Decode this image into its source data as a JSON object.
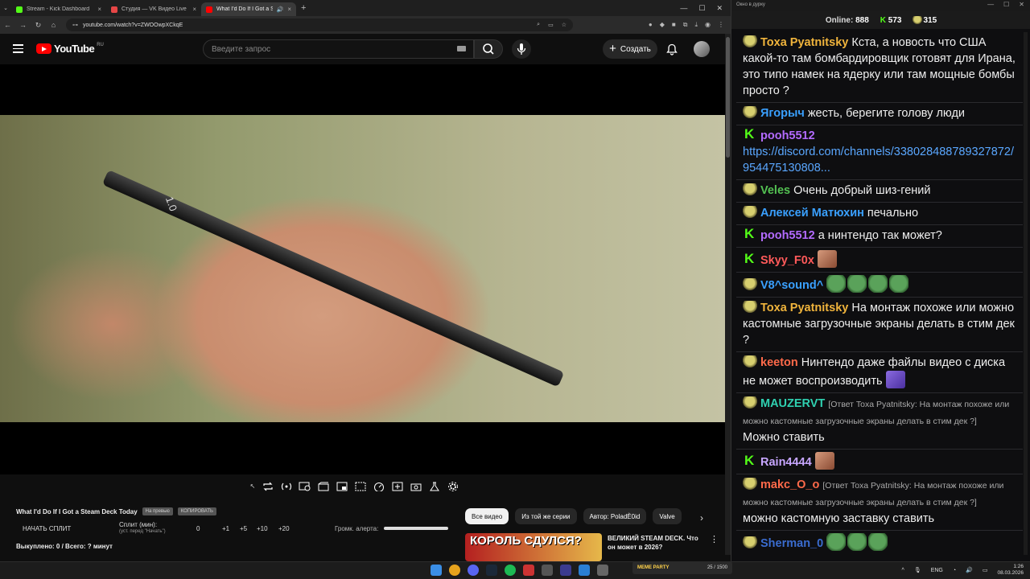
{
  "browser": {
    "tabs": [
      {
        "label": "Stream - Kick Dashboard",
        "color": "#53fc18"
      },
      {
        "label": "Студия — VK Видео Live",
        "color": "#e64646"
      },
      {
        "label": "What I'd Do If I Got a Steam",
        "color": "#ff0000"
      }
    ],
    "url": "youtube.com/watch?v=ZWOOwpXCkqE"
  },
  "youtube": {
    "logo": "YouTube",
    "region": "RU",
    "search_placeholder": "Введите запрос",
    "create_label": "Создать"
  },
  "video": {
    "pen_label": "1.0",
    "title": "What I'd Do If I Got a Steam Deck Today",
    "pill1": "На превью",
    "pill2": "КОПИРОВАТЬ",
    "start_split": "НАЧАТЬ СПЛИТ",
    "split_label": "Сплит (мин):",
    "split_sub": "(уст. перед \"Начать\")",
    "split_values": [
      "0",
      "+1",
      "+5",
      "+10",
      "+20"
    ],
    "alert_volume_label": "Громк. алерта:",
    "bought": "Выкуплено: 0 / Всего: ? минут"
  },
  "recommendations": {
    "chips": [
      "Все видео",
      "Из той же серии",
      "Автор: PoladЀ0id",
      "Valve"
    ],
    "first_title": "ВЕЛИКИЙ STEAM DECK. Что он может в 2026?",
    "thumb_text": "КОРОЛЬ СДУЛСЯ?"
  },
  "chat": {
    "window_title": "Окно в дурку",
    "online_label": "Online:",
    "online": "888",
    "kick_count": "573",
    "yt_count": "315",
    "messages": [
      {
        "badge": "yt",
        "nick": "Toxa Pyatnitsky",
        "color": "#f0b43c",
        "text": "Кста, а новость что США какой-то там бомбардировщик готовят для Ирана, это типо намек на ядерку или там мощные бомбы просто ?"
      },
      {
        "badge": "yt",
        "nick": "Ягорыч",
        "color": "#3aa0ff",
        "text": "жесть, берегите голову люди"
      },
      {
        "badge": "kick",
        "nick": "pooh5512",
        "color": "#b36bff",
        "text": "",
        "link": "https://discord.com/channels/338028488789327872/954475130808..."
      },
      {
        "badge": "yt",
        "nick": "Veles",
        "color": "#53c152",
        "text": "Очень добрый шиз-гений"
      },
      {
        "badge": "yt",
        "nick": "Алексей Матюхин",
        "color": "#3aa0ff",
        "text": "печально"
      },
      {
        "badge": "kick",
        "nick": "pooh5512",
        "color": "#b36bff",
        "text": "а нинтендо так может?"
      },
      {
        "badge": "kick",
        "nick": "Skyy_F0x",
        "color": "#ff5a5a",
        "text": "",
        "emotes": [
          "face"
        ]
      },
      {
        "badge": "yt",
        "nick": "V8^sound^",
        "color": "#3aa0ff",
        "text": "",
        "emotes": [
          "pepe",
          "pepe",
          "pepe",
          "pepe"
        ]
      },
      {
        "badge": "yt",
        "nick": "Toxa Pyatnitsky",
        "color": "#f0b43c",
        "text": "На монтаж похоже или можно кастомные загрузочные экраны делать в стим дек ?"
      },
      {
        "badge": "yt",
        "nick": "keeton",
        "color": "#ff6a4a",
        "text": "Нинтендо даже файлы видео с диска не может воспроизводить",
        "emotes": [
          "purple"
        ]
      },
      {
        "badge": "yt",
        "nick": "MAUZERVT",
        "color": "#2fd0b0",
        "reply": "[Ответ Toxa Pyatnitsky: На монтаж похоже или можно кастомные загрузочные экраны делать в стим дек ?]",
        "text": "Можно ставить"
      },
      {
        "badge": "kick",
        "nick": "Rain4444",
        "color": "#c7a6ff",
        "text": "",
        "emotes": [
          "face"
        ]
      },
      {
        "badge": "yt",
        "nick": "makc_O_o",
        "color": "#ff6a4a",
        "reply": "[Ответ Toxa Pyatnitsky: На монтаж похоже или можно кастомные загрузочные экраны делать в стим дек ?]",
        "text": "можно кастомную заставку ставить"
      },
      {
        "badge": "yt",
        "nick": "Sherman_0",
        "color": "#3a6ccf",
        "text": "",
        "emotes": [
          "pepe",
          "pepe",
          "pepe"
        ]
      }
    ]
  },
  "taskbar": {
    "meme_title": "MEME PARTY",
    "meme_count": "25 / 1500",
    "lang": "ENG",
    "time": "1:26",
    "date": "08.03.2026"
  }
}
